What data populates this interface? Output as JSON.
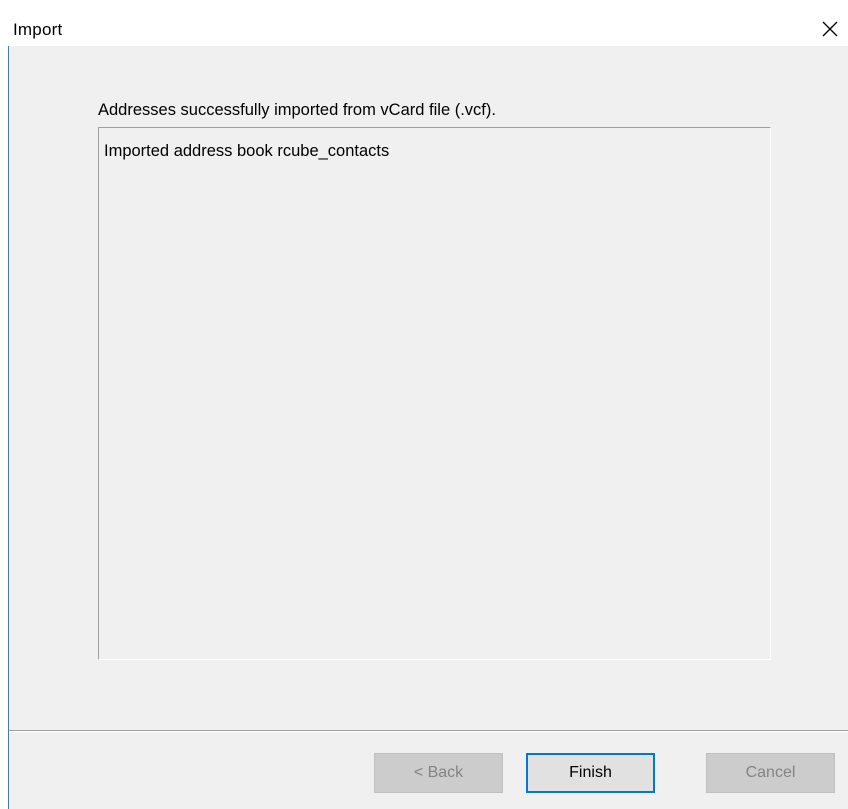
{
  "window": {
    "title": "Import",
    "close_icon": "close-icon"
  },
  "message": "Addresses successfully imported from vCard file (.vcf).",
  "log": {
    "lines": [
      "Imported address book rcube_contacts"
    ]
  },
  "buttons": {
    "back": {
      "label": "< Back",
      "enabled": false
    },
    "finish": {
      "label": "Finish",
      "enabled": true,
      "default": true
    },
    "cancel": {
      "label": "Cancel",
      "enabled": false
    }
  },
  "colors": {
    "accent": "#0078d7",
    "dialog_bg": "#f0f0f0"
  }
}
